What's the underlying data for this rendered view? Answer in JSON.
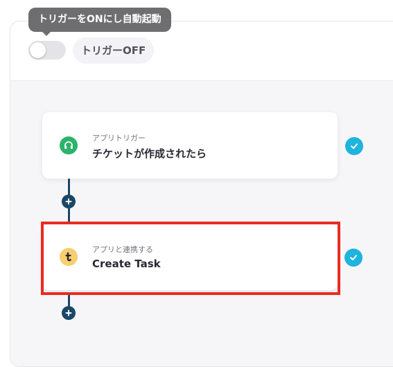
{
  "tooltip": {
    "text": "トリガーをONにし自動起動"
  },
  "trigger": {
    "state_label": "トリガーOFF",
    "enabled": false
  },
  "flow": {
    "steps": [
      {
        "subtitle": "アプリトリガー",
        "title": "チケットが作成されたら",
        "icon": "headset-icon",
        "status": "completed"
      },
      {
        "subtitle": "アプリと連携する",
        "title": "Create Task",
        "icon": "t-logo-icon",
        "status": "completed"
      }
    ]
  },
  "colors": {
    "check": "#1fb3dd",
    "connector": "#1a4866",
    "highlight": "#e92b21",
    "trigger_icon_bg": "#2bb36b",
    "task_icon_bg": "#f6cf70"
  }
}
